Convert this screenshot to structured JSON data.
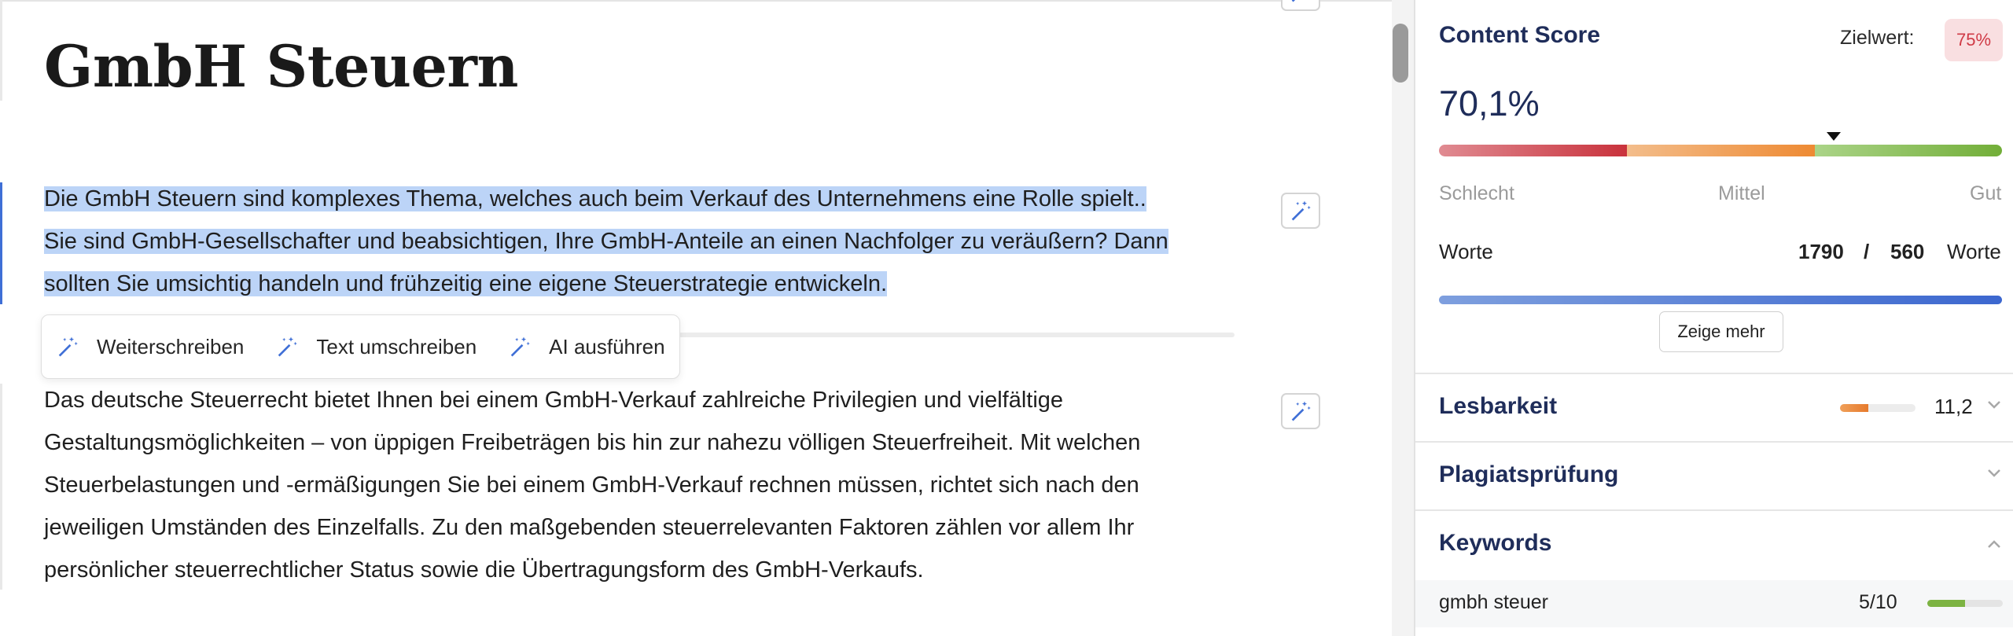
{
  "editor": {
    "title": "GmbH Steuern",
    "paragraph1_lines": [
      "Die GmbH Steuern sind komplexes Thema, welches auch beim Verkauf des Unternehmens eine Rolle spielt..",
      "Sie sind GmbH-Gesellschafter und beabsichtigen, Ihre GmbH-Anteile an einen Nachfolger zu veräußern? Dann",
      "sollten Sie umsichtig handeln und frühzeitig eine eigene Steuerstrategie entwickeln."
    ],
    "paragraph2_lines": [
      "Das deutsche Steuerrecht bietet Ihnen bei einem GmbH-Verkauf zahlreiche Privilegien und vielfältige",
      "Gestaltungsmöglichkeiten – von üppigen Freibeträgen bis hin zur nahezu völligen Steuerfreiheit. Mit welchen",
      "Steuerbelastungen und -ermäßigungen Sie bei einem GmbH-Verkauf rechnen müssen, richtet sich nach den",
      "jeweiligen Umständen des Einzelfalls. Zu den maßgebenden steuerrelevanten Faktoren zählen vor allem Ihr",
      "persönlicher steuerrechtlicher Status sowie die Übertragungsform des GmbH-Verkaufs."
    ],
    "selected_paragraph": 1,
    "toolbar": [
      {
        "label": "Weiterschreiben",
        "icon": "magic-wand-icon"
      },
      {
        "label": "Text umschreiben",
        "icon": "magic-wand-icon"
      },
      {
        "label": "AI ausführen",
        "icon": "magic-wand-icon"
      }
    ]
  },
  "sidebar": {
    "content_score": {
      "heading": "Content Score",
      "target_label": "Zielwert:",
      "target_value": "75%",
      "score": "70,1%",
      "score_value": 70.1,
      "scale_labels": [
        "Schlecht",
        "Mittel",
        "Gut"
      ],
      "words_label": "Worte",
      "words_current": "1790",
      "words_separator": "/",
      "words_target": "560",
      "words_unit": "Worte",
      "more_button": "Zeige mehr"
    },
    "readability": {
      "heading": "Lesbarkeit",
      "value": "11,2",
      "fill": 0.38
    },
    "plagiarism": {
      "heading": "Plagiatsprüfung"
    },
    "keywords": {
      "heading": "Keywords",
      "items": [
        {
          "keyword": "gmbh steuer",
          "count": "5/10",
          "progress": 0.5
        }
      ]
    },
    "colors": {
      "heading": "#1f2d5a",
      "accent": "#3c67cf",
      "selection": "#bcd4f7",
      "bad": "#d44b57",
      "medium": "#ef9a48",
      "good": "#7cb342"
    }
  }
}
